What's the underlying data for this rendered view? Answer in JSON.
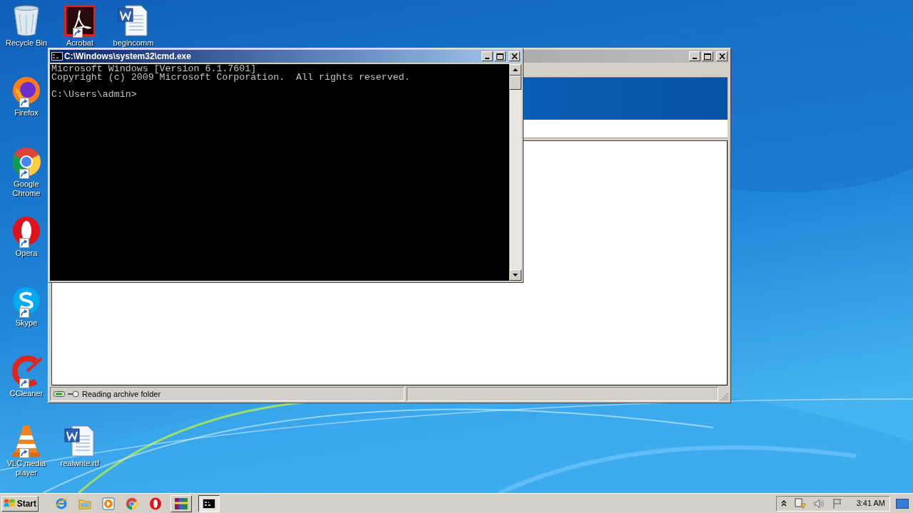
{
  "desktop_icons": [
    {
      "kind": "recycle",
      "label": "Recycle Bin",
      "shortcut": false
    },
    {
      "kind": "firefox",
      "label": "Firefox",
      "shortcut": true
    },
    {
      "kind": "chrome",
      "label": "Google Chrome",
      "shortcut": true
    },
    {
      "kind": "opera",
      "label": "Opera",
      "shortcut": true
    },
    {
      "kind": "skype",
      "label": "Skype",
      "shortcut": true
    },
    {
      "kind": "ccleaner",
      "label": "CCleaner",
      "shortcut": true
    },
    {
      "kind": "vlc",
      "label": "VLC media player",
      "shortcut": true
    },
    {
      "kind": "acrobat",
      "label": "Acrobat",
      "shortcut": true
    },
    {
      "kind": "word",
      "label": "begincomm",
      "shortcut": false
    },
    {
      "kind": "word",
      "label": "realwrite.rtf",
      "shortcut": false
    }
  ],
  "explorer_window": {
    "active": false,
    "status_text": "Reading archive folder"
  },
  "console_window": {
    "active": true,
    "title": "C:\\Windows\\system32\\cmd.exe",
    "blocks": [
      [
        "Microsoft Windows [Version 6.1.7601]",
        "Copyright (c) 2009 Microsoft Corporation.  All rights reserved."
      ],
      [
        "C:\\Users\\admin>"
      ]
    ]
  },
  "taskbar": {
    "start": "Start",
    "apps": [
      {
        "kind": "ie",
        "open": false,
        "selected": false
      },
      {
        "kind": "folder",
        "open": false,
        "selected": false
      },
      {
        "kind": "media",
        "open": false,
        "selected": false
      },
      {
        "kind": "chrome",
        "open": false,
        "selected": false
      },
      {
        "kind": "opera",
        "open": false,
        "selected": false
      },
      {
        "kind": "winrar",
        "open": true,
        "selected": false
      },
      {
        "kind": "console",
        "open": true,
        "selected": true
      }
    ],
    "clock": "3:41 AM"
  }
}
